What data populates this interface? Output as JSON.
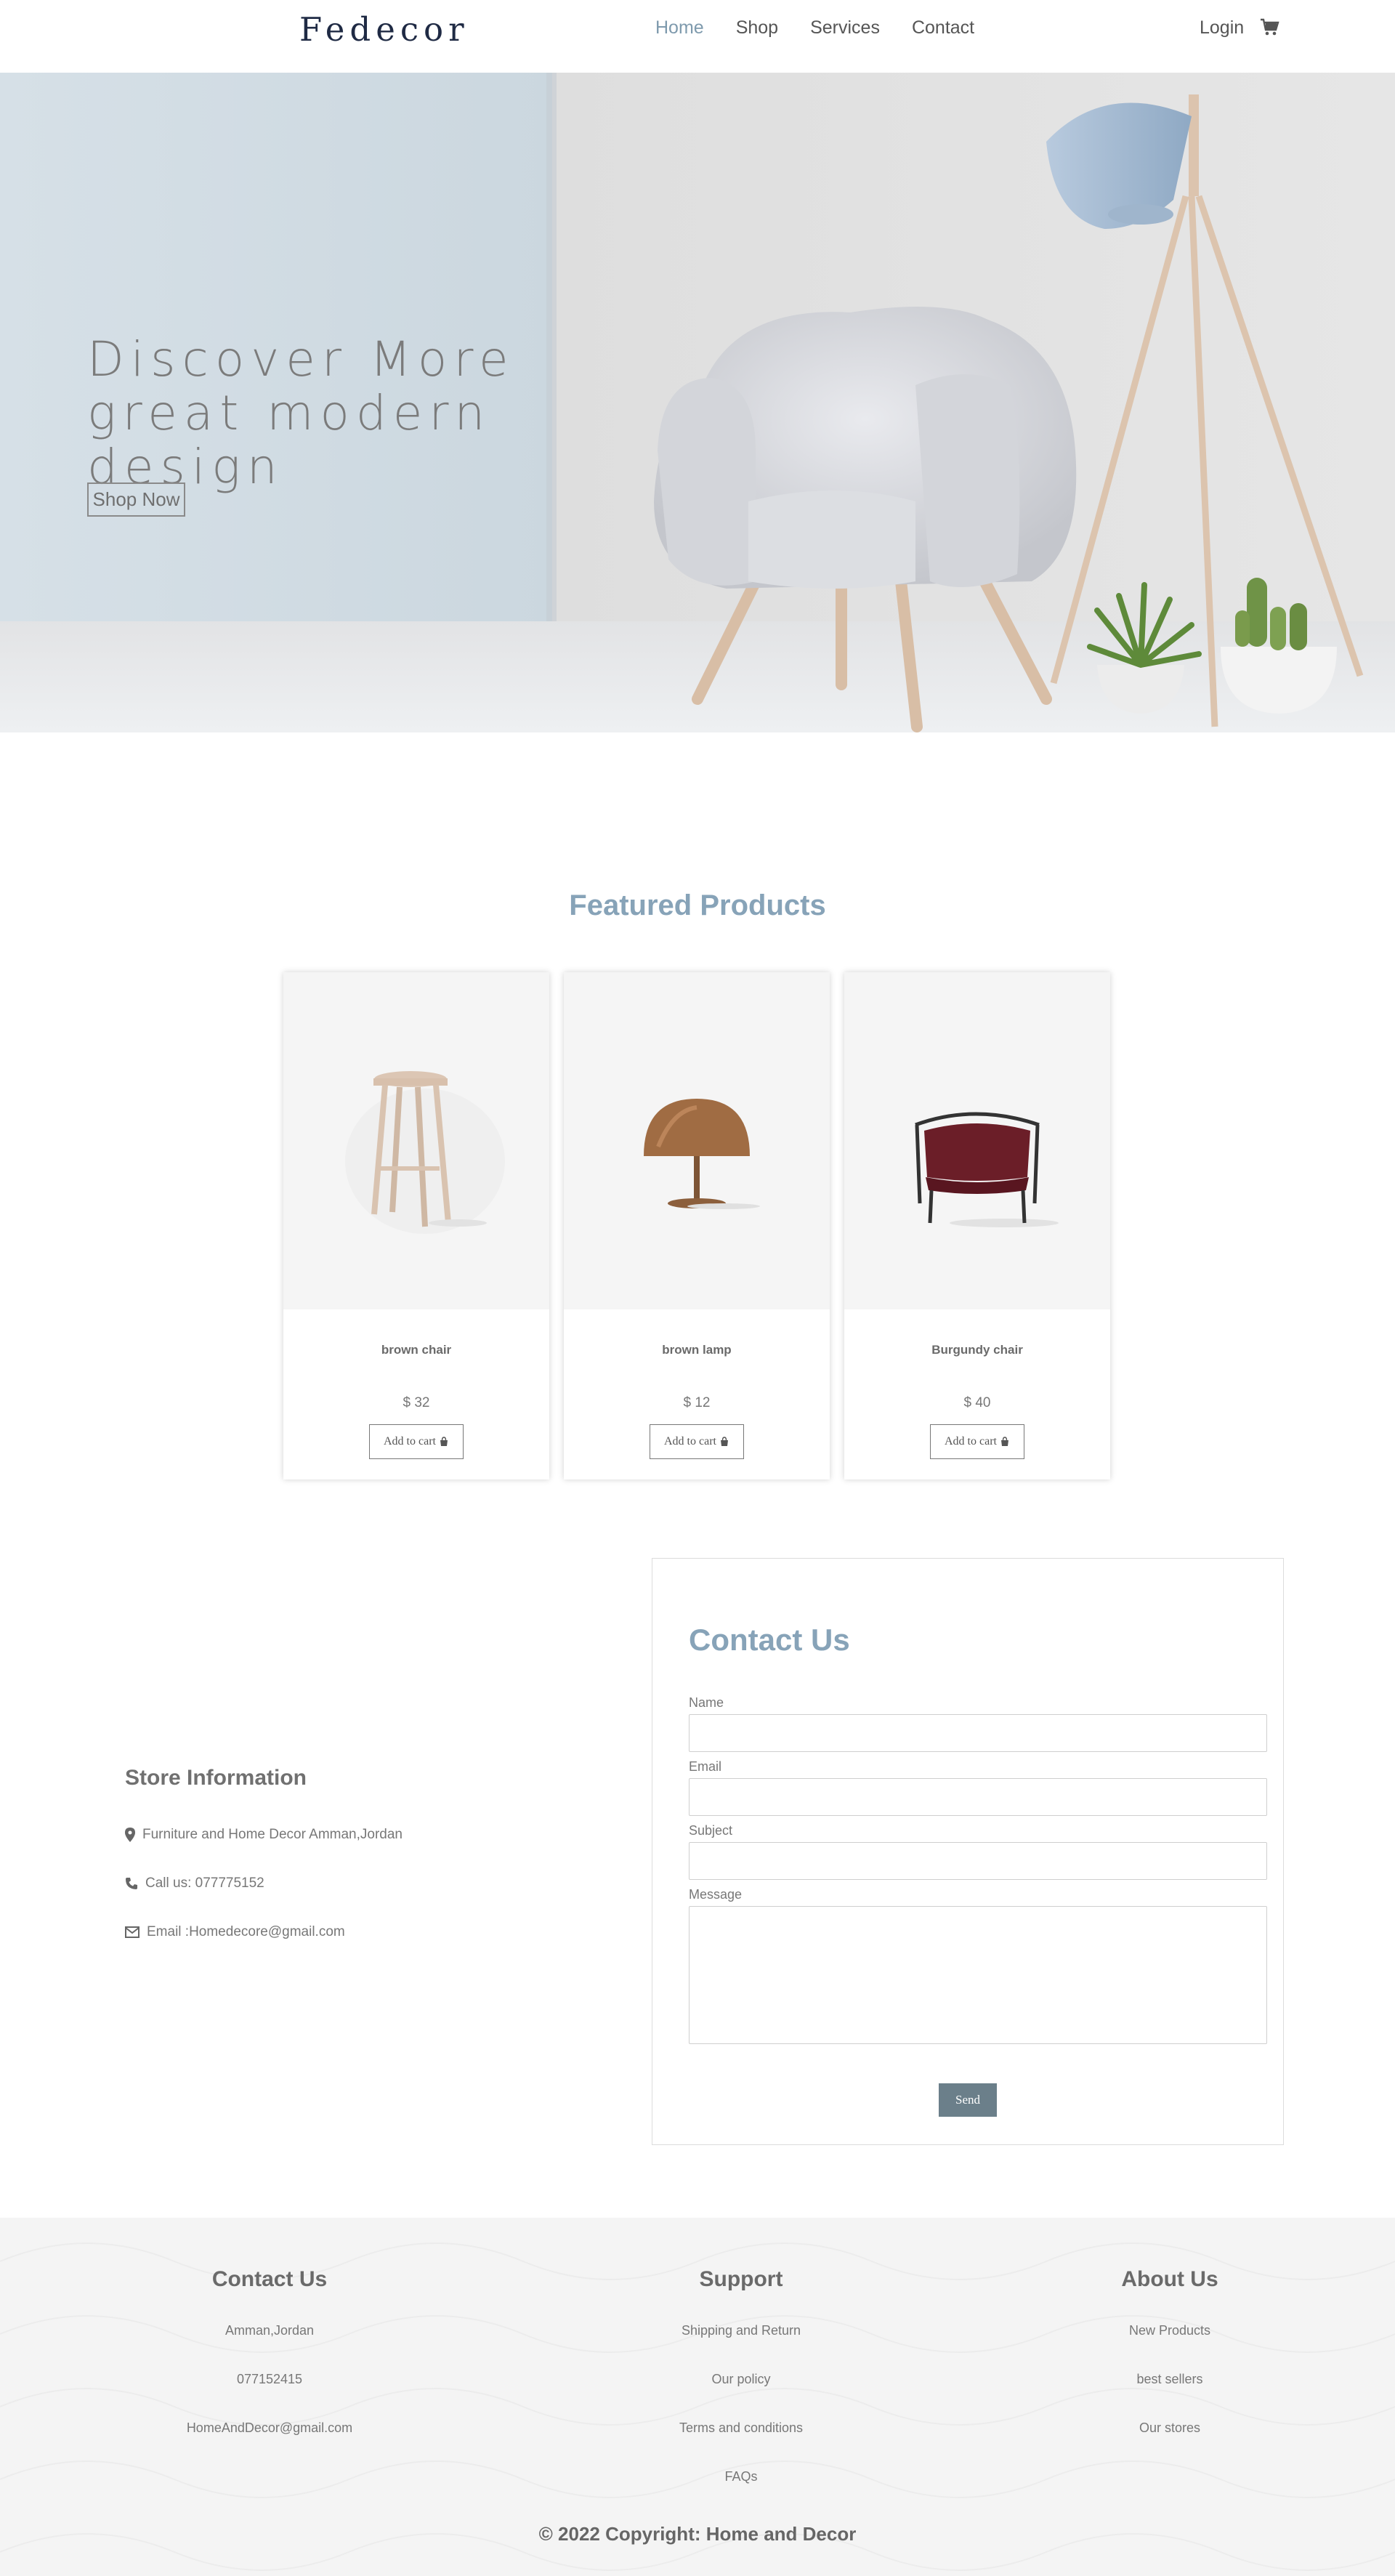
{
  "nav": {
    "logo": "Fedecor",
    "links": [
      "Home",
      "Shop",
      "Services",
      "Contact"
    ],
    "active_link": "Home",
    "login": "Login",
    "cart_icon": "shopping-cart-icon"
  },
  "hero": {
    "title": "Discover More great modern design",
    "button": "Shop Now"
  },
  "featured": {
    "title": "Featured Products",
    "products": [
      {
        "name": "brown chair",
        "price": "$ 32",
        "button": "Add to cart",
        "icon": "shopping-bag-icon"
      },
      {
        "name": "brown lamp",
        "price": "$ 12",
        "button": "Add to cart",
        "icon": "shopping-bag-icon"
      },
      {
        "name": "Burgundy chair",
        "price": "$ 40",
        "button": "Add to cart",
        "icon": "shopping-bag-icon"
      }
    ]
  },
  "store": {
    "title": "Store Information",
    "address": "Furniture and Home Decor Amman,Jordan",
    "phone": "Call us: 077775152",
    "email": "Email :Homedecore@gmail.com"
  },
  "contact_form": {
    "title": "Contact Us",
    "labels": [
      "Name",
      "Email",
      "Subject",
      "Message"
    ],
    "send": "Send"
  },
  "footer": {
    "columns": [
      {
        "title": "Contact Us",
        "items": [
          "Amman,Jordan",
          "077152415",
          "HomeAndDecor@gmail.com"
        ]
      },
      {
        "title": "Support",
        "items": [
          "Shipping and Return",
          "Our policy",
          "Terms and conditions",
          "FAQs"
        ]
      },
      {
        "title": "About Us",
        "items": [
          "New Products",
          "best sellers",
          "Our stores"
        ]
      }
    ],
    "copyright": "© 2022 Copyright: Home and Decor"
  },
  "colors": {
    "accent": "#87a3b8",
    "nav_active": "#7e9aad",
    "send_button": "#6b7f8a",
    "footer_bg": "#f4f4f4"
  }
}
